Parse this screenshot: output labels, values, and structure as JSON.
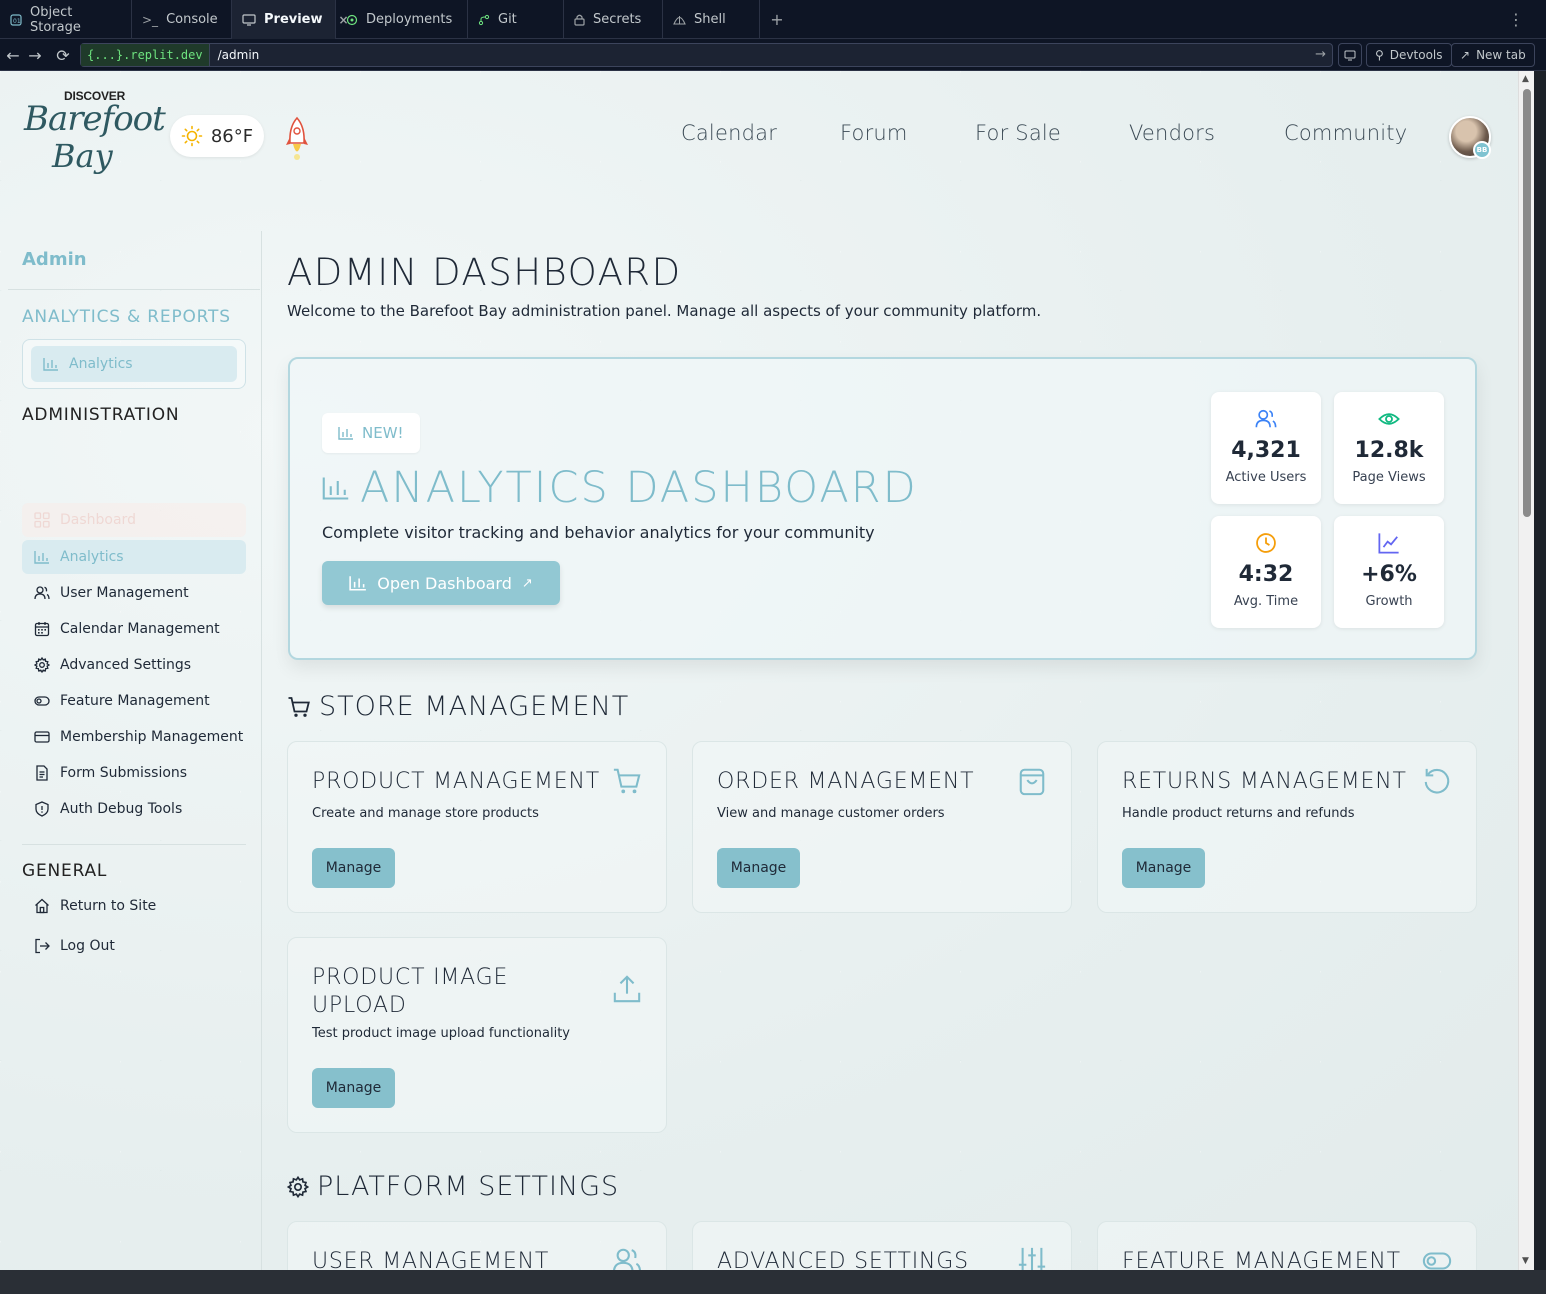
{
  "ide": {
    "tabs": [
      {
        "label": "Object Storage"
      },
      {
        "label": "Console"
      },
      {
        "label": "Preview",
        "close": "×"
      },
      {
        "label": "Deployments"
      },
      {
        "label": "Git"
      },
      {
        "label": "Secrets"
      },
      {
        "label": "Shell"
      }
    ],
    "add_tab": "+",
    "url_host_prefix": "{...}",
    "url_host_suffix": ".replit.dev",
    "url_path": "/admin",
    "devtools_label": "Devtools",
    "newtab_label": "New tab"
  },
  "site": {
    "logo": {
      "line1": "DISCOVER",
      "line2": "Barefoot",
      "line3": "Bay"
    },
    "weather": "86°F",
    "nav": [
      "Calendar",
      "Forum",
      "For Sale",
      "Vendors",
      "Community"
    ],
    "avatar_badge": "BB"
  },
  "sidebar": {
    "title": "Admin",
    "analytics_heading": "ANALYTICS & REPORTS",
    "analytics_link": "Analytics",
    "admin_heading": "ADMINISTRATION",
    "admin_items": [
      {
        "label": "Dashboard",
        "icon": "grid-icon"
      },
      {
        "label": "Analytics",
        "icon": "bar-chart-icon"
      },
      {
        "label": "User Management",
        "icon": "users-icon"
      },
      {
        "label": "Calendar Management",
        "icon": "calendar-icon"
      },
      {
        "label": "Advanced Settings",
        "icon": "gear-icon"
      },
      {
        "label": "Feature Management",
        "icon": "toggle-icon"
      },
      {
        "label": "Membership Management",
        "icon": "credit-card-icon"
      },
      {
        "label": "Form Submissions",
        "icon": "document-icon"
      },
      {
        "label": "Auth Debug Tools",
        "icon": "shield-icon"
      }
    ],
    "general_heading": "GENERAL",
    "general_items": [
      {
        "label": "Return to Site",
        "icon": "home-icon"
      },
      {
        "label": "Log Out",
        "icon": "logout-icon"
      }
    ]
  },
  "main": {
    "title": "ADMIN DASHBOARD",
    "subtitle": "Welcome to the Barefoot Bay administration panel. Manage all aspects of your community platform.",
    "hero": {
      "badge": "NEW!",
      "title": "ANALYTICS DASHBOARD",
      "subtitle": "Complete visitor tracking and behavior analytics for your community",
      "button": "Open Dashboard",
      "stats": [
        {
          "value": "4,321",
          "label": "Active Users",
          "color": "#3b82f6"
        },
        {
          "value": "12.8k",
          "label": "Page Views",
          "color": "#10b981"
        },
        {
          "value": "4:32",
          "label": "Avg. Time",
          "color": "#f59e0b"
        },
        {
          "value": "+6%",
          "label": "Growth",
          "color": "#6366f1"
        }
      ]
    },
    "store_heading": "STORE MANAGEMENT",
    "store_cards": [
      {
        "title": "PRODUCT MANAGEMENT",
        "desc": "Create and manage store products",
        "button": "Manage"
      },
      {
        "title": "ORDER MANAGEMENT",
        "desc": "View and manage customer orders",
        "button": "Manage"
      },
      {
        "title": "RETURNS MANAGEMENT",
        "desc": "Handle product returns and refunds",
        "button": "Manage"
      },
      {
        "title": "PRODUCT IMAGE UPLOAD",
        "desc": "Test product image upload functionality",
        "button": "Manage"
      }
    ],
    "platform_heading": "PLATFORM SETTINGS",
    "platform_cards": [
      {
        "title": "USER MANAGEMENT"
      },
      {
        "title": "ADVANCED SETTINGS"
      },
      {
        "title": "FEATURE MANAGEMENT"
      }
    ]
  },
  "colors": {
    "accent": "#7fbccb",
    "button": "#86c0cc",
    "text": "#1f2937",
    "ide_bg": "#0e1525"
  }
}
